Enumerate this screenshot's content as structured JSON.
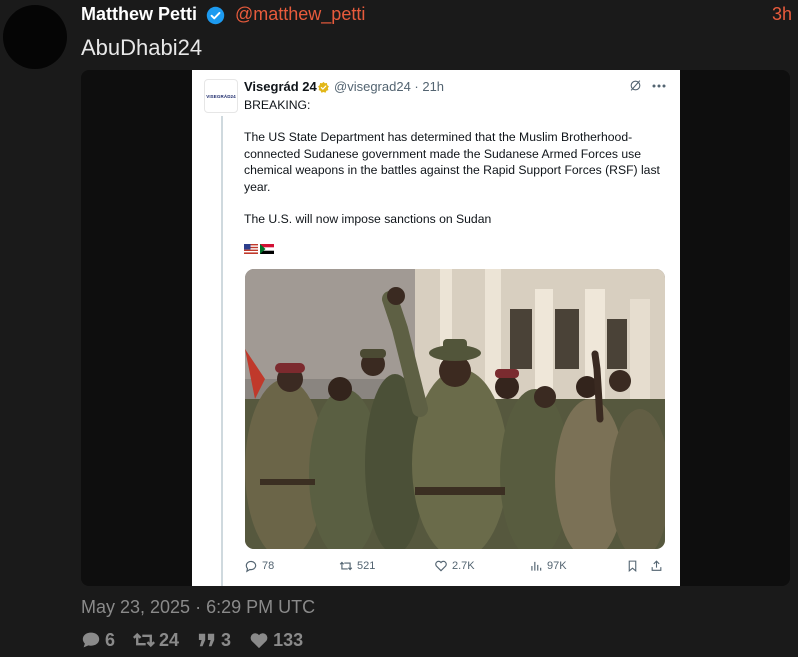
{
  "post": {
    "author_name": "Matthew Petti",
    "handle": "@matthew_petti",
    "time_ago": "3h",
    "text": "AbuDhabi24",
    "timestamp": "May 23, 2025 · 6:29 PM UTC",
    "stats": {
      "comments": "6",
      "reposts": "24",
      "quotes": "3",
      "likes": "133"
    }
  },
  "embed": {
    "avatar_text": "VISEGRÁD24",
    "name": "Visegrád 24",
    "handle_time": "@visegrad24 · 21h",
    "paragraphs": [
      "BREAKING:",
      "The US State Department has determined that the Muslim Brotherhood-connected Sudanese government made the Sudanese Armed Forces use chemical weapons in the battles against the Rapid Support Forces (RSF) last year.",
      "The U.S. will now impose sanctions on Sudan"
    ],
    "flags": [
      "us-flag",
      "sudan-flag"
    ],
    "actions": {
      "replies": "78",
      "reposts": "521",
      "likes": "2.7K",
      "views": "97K"
    }
  },
  "colors": {
    "accent": "#e85b3c",
    "verified": "#1d9bf0",
    "gold_badge": "#e2b719",
    "background": "#1a1a1a"
  }
}
